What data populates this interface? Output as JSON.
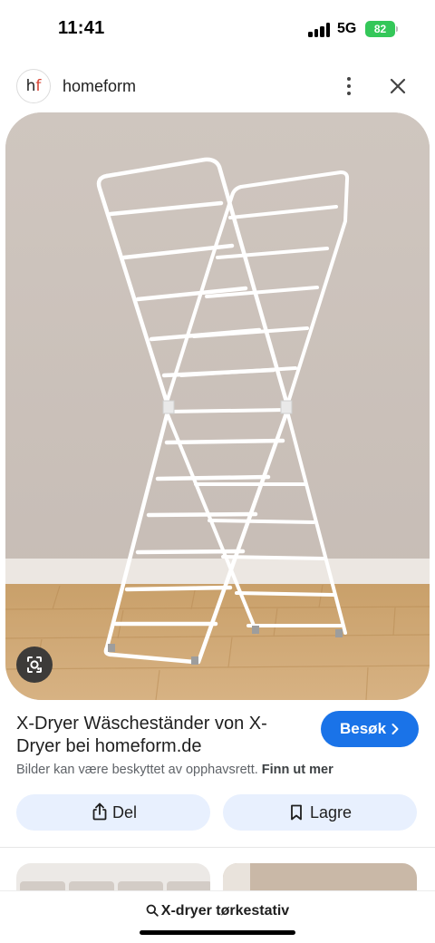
{
  "status_bar": {
    "time": "11:41",
    "network": "5G",
    "battery": "82",
    "battery_color": "#34c759"
  },
  "source": {
    "logo_letter_1": "h",
    "logo_letter_2": "f",
    "site_name": "homeform",
    "more_icon": "more-vert-icon",
    "close_icon": "close-icon"
  },
  "image": {
    "description_icon": "lens-icon"
  },
  "result": {
    "title": "X-Dryer Wäscheständer von X-Dryer bei homeform.de",
    "visit_label": "Besøk",
    "copyright_notice": "Bilder kan være beskyttet av opphavsrett.",
    "learn_more": "Finn ut mer",
    "accent_color": "#1a73e8"
  },
  "actions": {
    "share_label": "Del",
    "share_icon": "share-icon",
    "save_label": "Lagre",
    "save_icon": "bookmark-icon"
  },
  "bottom_bar": {
    "query": "X-dryer tørkestativ",
    "search_icon": "search-icon"
  }
}
